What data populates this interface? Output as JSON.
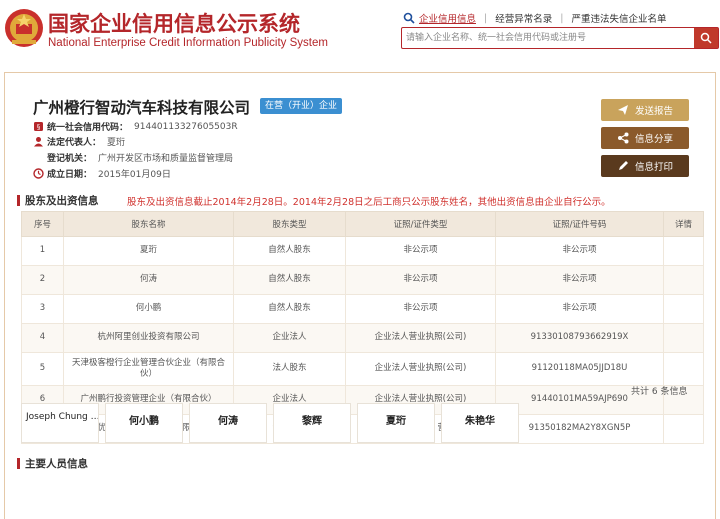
{
  "header": {
    "title_cn": "国家企业信用信息公示系统",
    "title_en": "National Enterprise Credit Information Publicity System",
    "nav": [
      {
        "label": "企业信用信息",
        "active": true
      },
      {
        "label": "经营异常名录",
        "active": false
      },
      {
        "label": "严重违法失信企业名单",
        "active": false
      }
    ],
    "search_placeholder": "请输入企业名称、统一社会信用代码或注册号"
  },
  "company": {
    "name": "广州橙行智动汽车科技有限公司",
    "status": "在营（开业）企业",
    "fields": [
      {
        "label": "统一社会信用代码：",
        "value": "91440113327605503R",
        "icon": "code-icon"
      },
      {
        "label": "法定代表人：",
        "value": "夏珩",
        "icon": "person-icon"
      },
      {
        "label": "登记机关：",
        "value": "广州开发区市场和质量监督管理局",
        "icon": ""
      },
      {
        "label": "成立日期：",
        "value": "2015年01月09日",
        "icon": "clock-icon"
      }
    ]
  },
  "actions": {
    "send_report": "发送报告",
    "share": "信息分享",
    "print": "信息打印"
  },
  "shareholders": {
    "title": "股东及出资信息",
    "notice": "股东及出资信息截止2014年2月28日。2014年2月28日之后工商只公示股东姓名，其他出资信息由企业自行公示。",
    "columns": [
      "序号",
      "股东名称",
      "股东类型",
      "证照/证件类型",
      "证照/证件号码",
      "详情"
    ],
    "rows": [
      [
        "1",
        "夏珩",
        "自然人股东",
        "非公示项",
        "非公示项",
        ""
      ],
      [
        "2",
        "何涛",
        "自然人股东",
        "非公示项",
        "非公示项",
        ""
      ],
      [
        "3",
        "何小鹏",
        "自然人股东",
        "非公示项",
        "非公示项",
        ""
      ],
      [
        "4",
        "杭州阿里创业投资有限公司",
        "企业法人",
        "企业法人营业执照(公司)",
        "91330108793662919X",
        ""
      ],
      [
        "5",
        "天津极客橙行企业管理合伙企业（有限合伙）",
        "法人股东",
        "企业法人营业执照(公司)",
        "91120118MA05JJD18U",
        ""
      ],
      [
        "6",
        "广州鹏行投资管理企业（有限合伙）",
        "企业法人",
        "企业法人营业执照(公司)",
        "91440101MA59AJP690",
        ""
      ],
      [
        "7",
        "福建优车投资合伙企业（有限合伙）",
        "合伙企业",
        "营业执照（分公司、营业单位）",
        "91350182MA2Y8XGN5P",
        ""
      ]
    ]
  },
  "personnel": {
    "title": "主要人员信息",
    "total": "共计 6 条信息",
    "people": [
      "Joseph Chung …",
      "何小鹏",
      "何涛",
      "黎辉",
      "夏珩",
      "朱艳华"
    ]
  },
  "colors": {
    "brand_red": "#b4262a",
    "badge_blue": "#3b8fd1",
    "gold": "#c9a35c",
    "brown": "#8b5a2b",
    "dark_brown": "#5a3a1e"
  }
}
